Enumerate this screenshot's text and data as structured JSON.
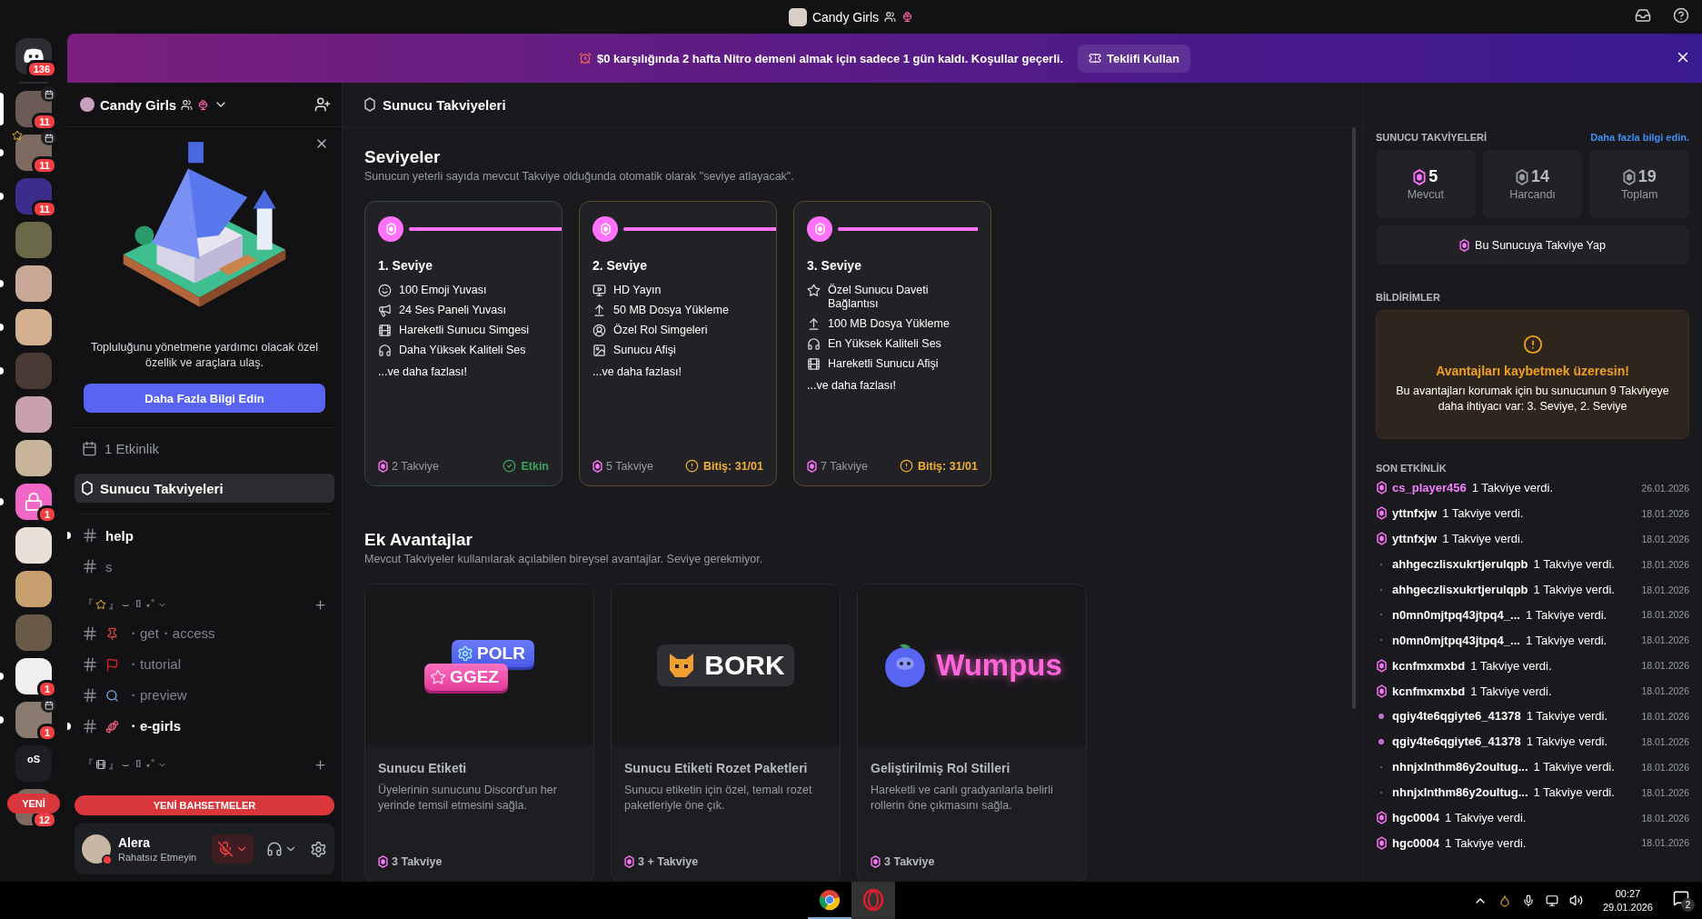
{
  "titlebar": {
    "title": "Candy Girls"
  },
  "banner": {
    "text": "$0 karşılığında 2 hafta Nitro demeni almak için sadece 1 gün kaldı. Koşullar geçerli.",
    "button": "Teklifi Kullan"
  },
  "rail": {
    "home_badge": "136",
    "servers": [
      {
        "kind": "photo",
        "badge": "11",
        "event": true,
        "star": false,
        "unread": false,
        "selected": true
      },
      {
        "kind": "photo",
        "badge": "11",
        "event": true,
        "star": true,
        "unread": true,
        "selected": false
      },
      {
        "kind": "photo",
        "badge": "11",
        "event": false,
        "star": false,
        "unread": true,
        "selected": false
      },
      {
        "kind": "photo",
        "event": false,
        "star": false,
        "unread": false,
        "selected": false
      },
      {
        "kind": "photo",
        "event": false,
        "star": false,
        "unread": true,
        "selected": false
      },
      {
        "kind": "photo",
        "event": false,
        "star": false,
        "unread": true,
        "selected": false
      },
      {
        "kind": "photo",
        "event": false,
        "star": false,
        "unread": true,
        "selected": false
      },
      {
        "kind": "photo",
        "event": false,
        "star": false,
        "unread": false,
        "selected": false
      },
      {
        "kind": "photo",
        "event": false,
        "star": false,
        "unread": false,
        "selected": false
      },
      {
        "kind": "lock",
        "badge": "1",
        "event": false,
        "star": false,
        "unread": true,
        "selected": false
      },
      {
        "kind": "photo",
        "event": false,
        "star": false,
        "unread": false,
        "selected": false
      },
      {
        "kind": "photo",
        "event": false,
        "star": false,
        "unread": false,
        "selected": false
      },
      {
        "kind": "photo",
        "event": false,
        "star": false,
        "unread": false,
        "selected": false
      },
      {
        "kind": "photo",
        "badge": "1",
        "event": false,
        "star": false,
        "unread": true,
        "selected": false
      },
      {
        "kind": "photo",
        "badge": "1",
        "event": true,
        "star": false,
        "unread": true,
        "selected": false
      },
      {
        "kind": "folder",
        "label": "oS",
        "event": false,
        "star": false,
        "unread": false,
        "selected": false
      },
      {
        "kind": "photo",
        "badge": "12",
        "event": false,
        "star": false,
        "unread": false,
        "selected": false
      }
    ],
    "new_pill": "YENİ"
  },
  "sidebar": {
    "server_name": "Candy Girls",
    "promo": {
      "text": "Topluluğunu yönetmene yardımcı olacak özel özellik ve araçlara ulaş.",
      "button": "Daha Fazla Bilgi Edin"
    },
    "nav": [
      {
        "kind": "events",
        "label": "1 Etkinlik",
        "selected": false
      },
      {
        "kind": "boosts",
        "label": "Sunucu Takviyeleri",
        "selected": true
      }
    ],
    "channels": [
      {
        "kind": "private",
        "name": "help",
        "unread": true
      },
      {
        "kind": "private",
        "name": "s",
        "unread": false
      },
      {
        "kind": "category",
        "open": "『",
        "close": "』",
        "tail": "⌣ ▯ ⋆˚"
      },
      {
        "kind": "text",
        "name": "・get・access",
        "unread": false
      },
      {
        "kind": "text",
        "name": "・tutorial",
        "unread": false
      },
      {
        "kind": "text",
        "name": "・preview",
        "unread": false
      },
      {
        "kind": "text",
        "name": "・e-girls",
        "unread": true
      },
      {
        "kind": "category",
        "open": "『",
        "close": "』",
        "tail": "⌣ ▯ ⋆˚"
      }
    ],
    "mentions_pill": "YENİ BAHSETMELER",
    "user": {
      "name": "Alera",
      "status": "Rahatsız Etmeyin",
      "muted": true
    }
  },
  "main": {
    "header": "Sunucu Takviyeleri",
    "levels": {
      "title": "Seviyeler",
      "subtitle": "Sunucun yeterli sayıda mevcut Takviye olduğunda otomatik olarak \"seviye atlayacak\".",
      "tiers": [
        {
          "title": "1. Seviye",
          "perks": [
            {
              "kind": "emoji",
              "text": "100 Emoji Yuvası"
            },
            {
              "kind": "soundboard",
              "text": "24 Ses Paneli Yuvası"
            },
            {
              "kind": "gif",
              "text": "Hareketli Sunucu Simgesi"
            },
            {
              "kind": "audio",
              "text": "Daha Yüksek Kaliteli Ses"
            }
          ],
          "more": "...ve daha fazlası!",
          "cost": "2 Takviye",
          "status": {
            "kind": "active",
            "text": "Etkin"
          }
        },
        {
          "title": "2. Seviye",
          "perks": [
            {
              "kind": "stream",
              "text": "HD Yayın"
            },
            {
              "kind": "upload",
              "text": "50 MB Dosya Yükleme"
            },
            {
              "kind": "role",
              "text": "Özel Rol Simgeleri"
            },
            {
              "kind": "banner",
              "text": "Sunucu Afişi"
            }
          ],
          "more": "...ve daha fazlası!",
          "cost": "5 Takviye",
          "status": {
            "kind": "expiring",
            "text": "Bitiş: 31/01"
          }
        },
        {
          "title": "3. Seviye",
          "perks": [
            {
              "kind": "invite",
              "text": "Özel Sunucu Daveti Bağlantısı"
            },
            {
              "kind": "upload",
              "text": "100 MB Dosya Yükleme"
            },
            {
              "kind": "audio",
              "text": "En Yüksek Kaliteli Ses"
            },
            {
              "kind": "gif",
              "text": "Hareketli Sunucu Afişi"
            }
          ],
          "more": "...ve daha fazlası!",
          "cost": "7 Takviye",
          "status": {
            "kind": "expiring",
            "text": "Bitiş: 31/01"
          }
        }
      ]
    },
    "extras": {
      "title": "Ek Avantajlar",
      "subtitle": "Mevcut Takviyeler kullanılarak açılabilen bireysel avantajlar. Seviye gerekmiyor.",
      "perks": [
        {
          "art": {
            "kind": "tags",
            "labels": [
              "POLR",
              "GGEZ"
            ]
          },
          "title": "Sunucu Etiketi",
          "text": "Üyelerinin sunucunu Discord'un her yerinde temsil etmesini sağla.",
          "cost": "3 Takviye"
        },
        {
          "art": {
            "kind": "badge",
            "labels": [
              "BORK"
            ]
          },
          "title": "Sunucu Etiketi Rozet Paketleri",
          "text": "Sunucu etiketin için özel, temalı rozet paketleriyle öne çık.",
          "cost": "3 + Takviye"
        },
        {
          "art": {
            "kind": "role",
            "labels": [
              "Wumpus"
            ]
          },
          "title": "Geliştirilmiş Rol Stilleri",
          "text": "Hareketli ve canlı gradyanlarla belirli rollerin öne çıkmasını sağla.",
          "cost": "3 Takviye"
        }
      ]
    }
  },
  "panel": {
    "boosts": {
      "title": "SUNUCU TAKVİYELERİ",
      "link": "Daha fazla bilgi edin.",
      "stats": [
        {
          "value": "5",
          "label": "Mevcut",
          "highlight": true
        },
        {
          "value": "14",
          "label": "Harcandı",
          "highlight": false
        },
        {
          "value": "19",
          "label": "Toplam",
          "highlight": false
        }
      ],
      "button": "Bu Sunucuya Takviye Yap"
    },
    "notifications": {
      "title": "BİLDİRİMLER",
      "heading": "Avantajları kaybetmek üzeresin!",
      "text": "Bu avantajları korumak için bu sunucunun 9 Takviyeye daha ihtiyacı var: 3. Seviye, 2. Seviye"
    },
    "activity": {
      "title": "SON ETKİNLİK",
      "rows": [
        {
          "kind": "gem",
          "name": "cs_player456",
          "color": "#f47fff",
          "text": "1 Takviye verdi.",
          "date": "26.01.2026"
        },
        {
          "kind": "gem",
          "name": "yttnfxjw",
          "color": "#ffffff",
          "text": "1 Takviye verdi.",
          "date": "18.01.2026"
        },
        {
          "kind": "gem",
          "name": "yttnfxjw",
          "color": "#ffffff",
          "text": "1 Takviye verdi.",
          "date": "18.01.2026"
        },
        {
          "kind": "speck",
          "name": "ahhgeczlisxukrtjerulqpb",
          "color": "#ffffff",
          "text": "1 Takviye verdi.",
          "date": "18.01.2026"
        },
        {
          "kind": "speck",
          "name": "ahhgeczlisxukrtjerulqpb",
          "color": "#ffffff",
          "text": "1 Takviye verdi.",
          "date": "18.01.2026"
        },
        {
          "kind": "speck",
          "name": "n0mn0mjtpq43jtpq4_...",
          "color": "#ffffff",
          "text": "1 Takviye verdi.",
          "date": "18.01.2026"
        },
        {
          "kind": "speck",
          "name": "n0mn0mjtpq43jtpq4_...",
          "color": "#ffffff",
          "text": "1 Takviye verdi.",
          "date": "18.01.2026"
        },
        {
          "kind": "gem",
          "name": "kcnfmxmxbd",
          "color": "#ffffff",
          "text": "1 Takviye verdi.",
          "date": "18.01.2026"
        },
        {
          "kind": "gem",
          "name": "kcnfmxmxbd",
          "color": "#ffffff",
          "text": "1 Takviye verdi.",
          "date": "18.01.2026"
        },
        {
          "kind": "orb",
          "name": "qgiy4te6qgiyte6_41378",
          "color": "#ffffff",
          "text": "1 Takviye verdi.",
          "date": "18.01.2026"
        },
        {
          "kind": "orb",
          "name": "qgiy4te6qgiyte6_41378",
          "color": "#ffffff",
          "text": "1 Takviye verdi.",
          "date": "18.01.2026"
        },
        {
          "kind": "speck",
          "name": "nhnjxlnthm86y2oultug...",
          "color": "#ffffff",
          "text": "1 Takviye verdi.",
          "date": "18.01.2026"
        },
        {
          "kind": "speck",
          "name": "nhnjxlnthm86y2oultug...",
          "color": "#ffffff",
          "text": "1 Takviye verdi.",
          "date": "18.01.2026"
        },
        {
          "kind": "gem",
          "name": "hgc0004",
          "color": "#ffffff",
          "text": "1 Takviye verdi.",
          "date": "18.01.2026"
        },
        {
          "kind": "gem",
          "name": "hgc0004",
          "color": "#ffffff",
          "text": "1 Takviye verdi.",
          "date": "18.01.2026"
        }
      ]
    }
  },
  "taskbar": {
    "apps": [
      {
        "kind": "chrome",
        "selected": false
      },
      {
        "kind": "opera",
        "selected": true
      }
    ],
    "time": "00:27",
    "date": "29.01.2026",
    "notifications": "2"
  }
}
